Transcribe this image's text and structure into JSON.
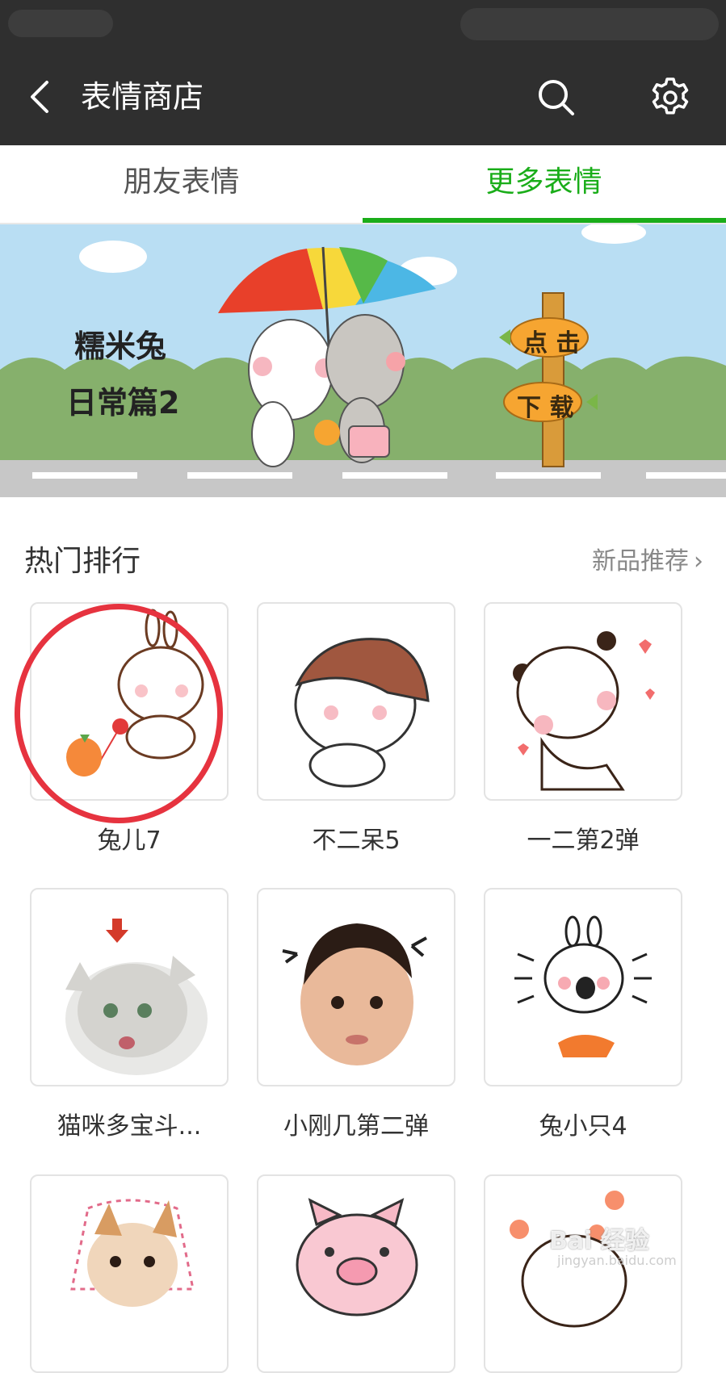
{
  "header": {
    "title": "表情商店",
    "icons": [
      "back-arrow-icon",
      "search-icon",
      "gear-icon"
    ]
  },
  "tabs": [
    {
      "label": "朋友表情",
      "active": false
    },
    {
      "label": "更多表情",
      "active": true
    }
  ],
  "banner": {
    "line1": "糯米兔",
    "line2": "日常篇2",
    "sign_top": "点 击",
    "sign_bottom": "下 载"
  },
  "section": {
    "title": "热门排行",
    "more": "新品推荐"
  },
  "grid": {
    "items": [
      {
        "label": "兔儿7"
      },
      {
        "label": "不二呆5"
      },
      {
        "label": "一二第2弹"
      },
      {
        "label": "猫咪多宝斗..."
      },
      {
        "label": "小刚几第二弹"
      },
      {
        "label": "兔小只4"
      },
      {
        "label": ""
      },
      {
        "label": ""
      },
      {
        "label": ""
      }
    ]
  },
  "watermark": {
    "text": "Bai 经验",
    "url": "jingyan.baidu.com"
  },
  "colors": {
    "accent": "#1aad19",
    "appbar": "#2f2f2f",
    "highlight": "#e6333f"
  }
}
